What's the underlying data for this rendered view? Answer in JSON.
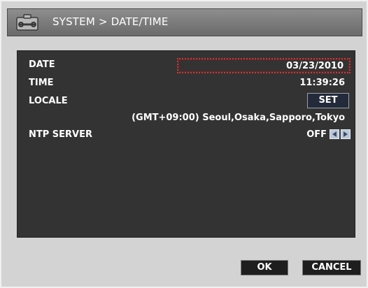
{
  "header": {
    "title": "SYSTEM > DATE/TIME"
  },
  "settings": {
    "date_label": "DATE",
    "date_value": "03/23/2010",
    "time_label": "TIME",
    "time_value": "11:39:26",
    "locale_label": "LOCALE",
    "locale_set_label": "SET",
    "locale_value": "(GMT+09:00) Seoul,Osaka,Sapporo,Tokyo",
    "ntp_label": "NTP SERVER",
    "ntp_value": "OFF"
  },
  "footer": {
    "ok_label": "OK",
    "cancel_label": "CANCEL"
  },
  "icons": {
    "header": "wrench-icon",
    "ntp_prev": "arrow-left-icon",
    "ntp_next": "arrow-right-icon"
  },
  "colors": {
    "title_bar": "#7c7c7c",
    "panel": "#333333",
    "focus_border": "#c83a3a",
    "window_bg": "#d3d3d3"
  }
}
